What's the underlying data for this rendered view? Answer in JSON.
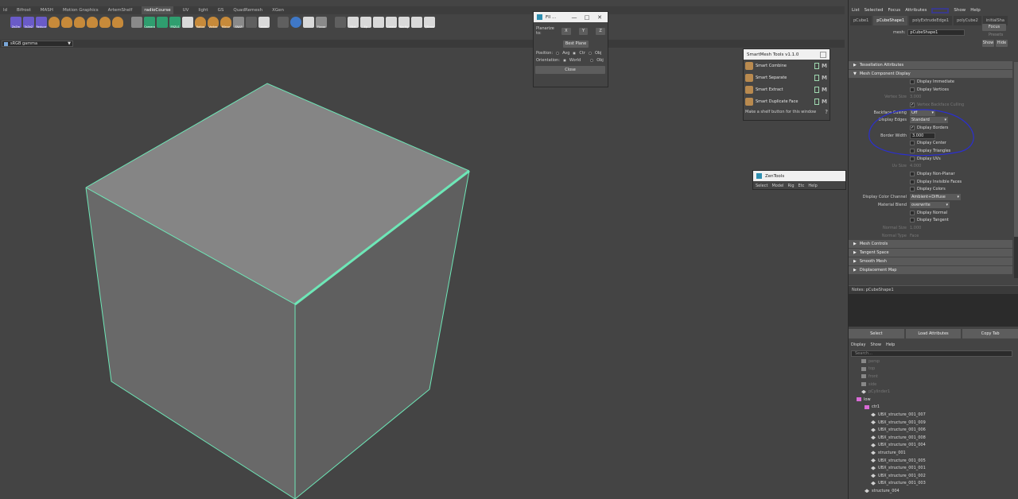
{
  "shelf": {
    "tabs": [
      "ld",
      "Bifrost",
      "MASH",
      "Motion Graphics",
      "ArtemShelf",
      "radioCourse",
      "UV",
      "light",
      "GS",
      "QuadRemesh",
      "XGen"
    ],
    "active_tab": "radioCourse",
    "icon_labels": [
      "ZeZm",
      "TeZeZ",
      "Reduce",
      "",
      "",
      "",
      "",
      "",
      "",
      "",
      "Camera",
      "",
      "FRZLS",
      "",
      "Ratios",
      "Vertex",
      "Mirror",
      "SNAP",
      "",
      "anim",
      "",
      "",
      "",
      "Planar",
      "",
      "Bkrt",
      "Ep",
      "",
      "Create",
      "NarHg",
      "",
      "QDraw"
    ]
  },
  "viewport": {
    "colorspace": "sRGB gamma"
  },
  "flatten_window": {
    "title": "Fll ...",
    "planarize_label": "Planarize to:",
    "axis_buttons": [
      "X",
      "Y",
      "Z"
    ],
    "best_plane": "Best Plane",
    "position_label": "Position:",
    "position_options": [
      "Avg",
      "Ctr",
      "Obj"
    ],
    "orientation_label": "Orientation:",
    "orientation_options": [
      "World",
      "Obj"
    ],
    "close": "Close"
  },
  "smartmesh": {
    "title": "SmartMesh Tools v1.1.0",
    "items": [
      "Smart Combine",
      "Smart Separate",
      "Smart Extract",
      "Smart Duplicate Face"
    ],
    "footer": "Make a shelf button for this window",
    "help": "?"
  },
  "zentools": {
    "title": "ZenTools",
    "menu": [
      "Select",
      "Model",
      "Rig",
      "Etc",
      "Help"
    ]
  },
  "attribute_editor": {
    "menu": [
      "List",
      "Selected",
      "Focus",
      "Attributes",
      "Show",
      "Help"
    ],
    "node_tabs": [
      "pCube1",
      "pCubeShape1",
      "polyExtrudeEdge1",
      "polyCube2",
      "initialSha"
    ],
    "active_node_tab": "pCubeShape1",
    "mesh_label": "mesh:",
    "mesh_value": "pCubeShape1",
    "focus": "Focus",
    "presets": "Presets",
    "show": "Show",
    "hide": "Hide",
    "sections": {
      "tessellation": "Tessellation Attributes",
      "mesh_component_display": "Mesh Component Display",
      "mesh_controls": "Mesh Controls",
      "tangent_space": "Tangent Space",
      "smooth_mesh": "Smooth Mesh",
      "displacement_map": "Displacement Map"
    },
    "display_immediate": "Display Immediate",
    "display_vertices": "Display Vertices",
    "vertex_size_label": "Vertex Size",
    "vertex_size_value": "3.000",
    "vertex_backface": "Vertex Backface Culling",
    "backface_label": "Backface Culling",
    "backface_value": "Off",
    "display_edges_label": "Display Edges",
    "display_edges_value": "Standard",
    "display_borders": "Display Borders",
    "border_width_label": "Border Width",
    "border_width_value": "3.000",
    "display_center": "Display Center",
    "display_triangles": "Display Triangles",
    "display_uvs": "Display UVs",
    "uv_size_label": "Uv Size",
    "uv_size_value": "4.000",
    "display_nonplanar": "Display Non-Planar",
    "display_invisible": "Display Invisible Faces",
    "display_colors": "Display Colors",
    "color_channel_label": "Display Color Channel",
    "color_channel_value": "Ambient+Diffuse",
    "material_blend_label": "Material Blend",
    "material_blend_value": "overwrite",
    "display_normal": "Display Normal",
    "display_tangent": "Display Tangent",
    "normal_size_label": "Normal Size",
    "normal_size_value": "1.000",
    "normal_type_label": "Normal Type",
    "normal_type_value": "Face",
    "notes": "Notes: pCubeShape1",
    "buttons": [
      "Select",
      "Load Attributes",
      "Copy Tab"
    ]
  },
  "outliner": {
    "menu": [
      "Display",
      "Show",
      "Help"
    ],
    "search": "Search...",
    "items": [
      {
        "label": "persp",
        "dim": true,
        "indent": 16,
        "icon": "cam"
      },
      {
        "label": "top",
        "dim": true,
        "indent": 16,
        "icon": "cam"
      },
      {
        "label": "front",
        "dim": true,
        "indent": 16,
        "icon": "cam"
      },
      {
        "label": "side",
        "dim": true,
        "indent": 16,
        "icon": "cam"
      },
      {
        "label": "pCylinder1",
        "dim": true,
        "indent": 16,
        "icon": "mesh"
      },
      {
        "label": "low",
        "dim": false,
        "indent": 10,
        "icon": "grp"
      },
      {
        "label": "ctr1",
        "dim": false,
        "indent": 20,
        "icon": "grp"
      },
      {
        "label": "UBX_structure_001_007",
        "dim": false,
        "indent": 28,
        "icon": "mesh"
      },
      {
        "label": "UBX_structure_001_009",
        "dim": false,
        "indent": 28,
        "icon": "mesh"
      },
      {
        "label": "UBX_structure_001_006",
        "dim": false,
        "indent": 28,
        "icon": "mesh"
      },
      {
        "label": "UBX_structure_001_008",
        "dim": false,
        "indent": 28,
        "icon": "mesh"
      },
      {
        "label": "UBX_structure_001_004",
        "dim": false,
        "indent": 28,
        "icon": "mesh"
      },
      {
        "label": "structure_001",
        "dim": false,
        "indent": 28,
        "icon": "mesh"
      },
      {
        "label": "UBX_structure_001_005",
        "dim": false,
        "indent": 28,
        "icon": "mesh"
      },
      {
        "label": "UBX_structure_001_001",
        "dim": false,
        "indent": 28,
        "icon": "mesh"
      },
      {
        "label": "UBX_structure_001_002",
        "dim": false,
        "indent": 28,
        "icon": "mesh"
      },
      {
        "label": "UBX_structure_001_003",
        "dim": false,
        "indent": 28,
        "icon": "mesh"
      },
      {
        "label": "structure_004",
        "dim": false,
        "indent": 20,
        "icon": "mesh"
      }
    ]
  },
  "colors": {
    "selection_edge": "#6ee7b7",
    "annotation": "#2b2fd0"
  }
}
